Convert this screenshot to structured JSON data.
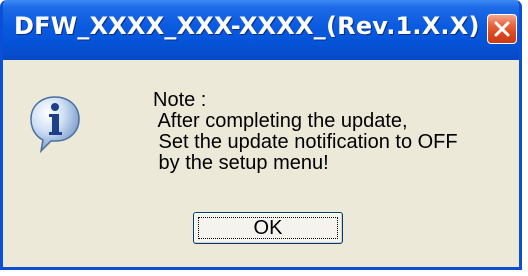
{
  "window": {
    "title": "DFW_XXXX_XXX-XXXX_(Rev.1.X.X)"
  },
  "dialog": {
    "icon": "info-icon",
    "message_lines": [
      "Note :",
      " After completing the update,",
      " Set the update notification to OFF",
      " by the setup menu!"
    ],
    "ok_label": "OK"
  },
  "colors": {
    "titlebar": "#0554d8",
    "close_button": "#e0532b",
    "dialog_background": "#ece9d8"
  }
}
